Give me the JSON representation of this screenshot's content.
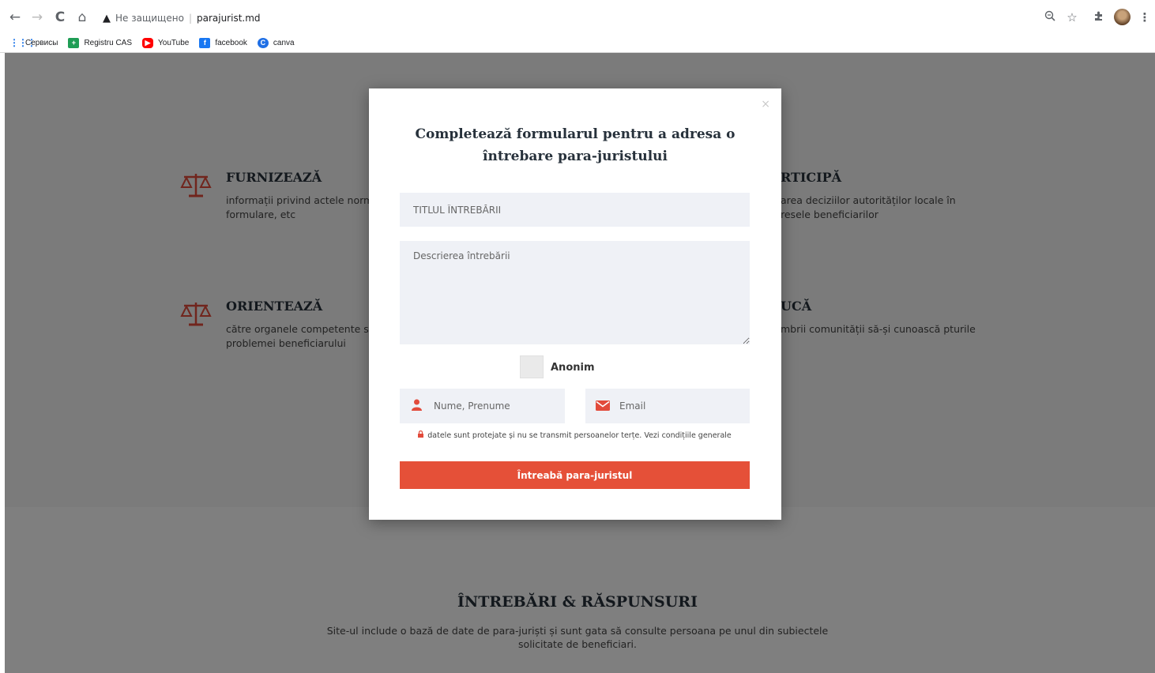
{
  "browser": {
    "back_icon": "←",
    "forward_icon": "→",
    "reload_icon": "C",
    "home_icon": "⌂",
    "insecure_label": "Не защищено",
    "separator": "|",
    "url": "parajurist.md",
    "bookmarks": [
      {
        "label": "Сервисы",
        "icon": "apps-grid-icon",
        "glyph": "⋮⋮⋮"
      },
      {
        "label": "Registru CAS",
        "icon": "cas-icon",
        "glyph": "+"
      },
      {
        "label": "YouTube",
        "icon": "youtube-icon",
        "glyph": "▶"
      },
      {
        "label": "facebook",
        "icon": "facebook-icon",
        "glyph": "f"
      },
      {
        "label": "canva",
        "icon": "canva-icon",
        "glyph": "C"
      }
    ]
  },
  "features": [
    {
      "title": "FURNIZEAZĂ",
      "text": "informații privind actele norm formulare, etc"
    },
    {
      "title": "RTICIPĂ",
      "text": "area deciziilor autorităților locale în resele beneficiarilor"
    },
    {
      "title": "ORIENTEAZĂ",
      "text": "către organele competente sc problemei beneficiarului"
    },
    {
      "title": "UCĂ",
      "text": "mbrii comunității să-și cunoască pturile"
    }
  ],
  "section2": {
    "title": "ÎNTREBĂRI & RĂSPUNSURI",
    "text": "Site-ul include o bază de date de para-juriști și sunt gata să consulte persoana pe unul din subiectele solicitate de beneficiari."
  },
  "modal": {
    "close_label": "×",
    "title": "Completează formularul pentru a adresa o întrebare para-juristului",
    "title_placeholder": "TITLUL ÎNTREBĂRII",
    "description_placeholder": "Descrierea întrebării",
    "anonymous_label": "Anonim",
    "name_placeholder": "Nume, Prenume",
    "email_placeholder": "Email",
    "privacy_text": "datele sunt protejate și nu se transmit persoanelor terțe. Vezi condițiile generale",
    "submit_label": "Întreabă para-juristul"
  },
  "colors": {
    "accent": "#e55038",
    "input_bg": "#eff1f6",
    "heading": "#27313b"
  }
}
